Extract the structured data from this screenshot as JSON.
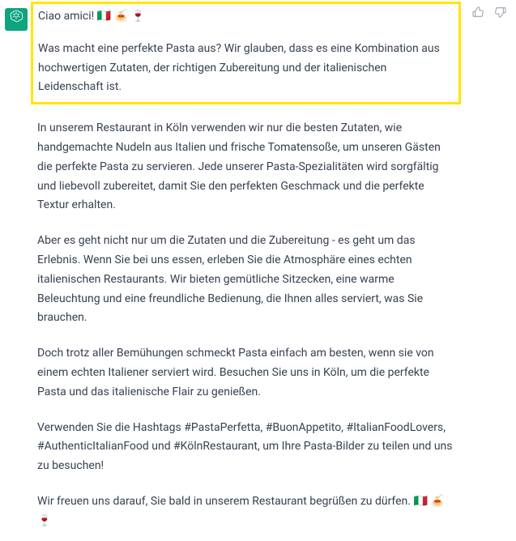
{
  "message": {
    "p1_a": "Ciao amici! 🇮🇹 🍝 🍷",
    "p1_b": "Was macht eine perfekte Pasta aus? Wir glauben, dass es eine Kombination aus hochwertigen Zutaten, der richtigen Zubereitung und der italienischen Leidenschaft ist.",
    "p2": "In unserem Restaurant in Köln verwenden wir nur die besten Zutaten, wie handgemachte Nudeln aus Italien und frische Tomatensoße, um unseren Gästen die perfekte Pasta zu servieren. Jede unserer Pasta-Spezialitäten wird sorgfältig und liebevoll zubereitet, damit Sie den perfekten Geschmack und die perfekte Textur erhalten.",
    "p3": "Aber es geht nicht nur um die Zutaten und die Zubereitung - es geht um das Erlebnis. Wenn Sie bei uns essen, erleben Sie die Atmosphäre eines echten italienischen Restaurants. Wir bieten gemütliche Sitzecken, eine warme Beleuchtung und eine freundliche Bedienung, die Ihnen alles serviert, was Sie brauchen.",
    "p4": "Doch trotz aller Bemühungen schmeckt Pasta einfach am besten, wenn sie von einem echten Italiener serviert wird. Besuchen Sie uns in Köln, um die perfekte Pasta und das italienische Flair zu genießen.",
    "p5": "Verwenden Sie die Hashtags #PastaPerfetta, #BuonAppetito, #ItalianFoodLovers, #AuthenticItalianFood und #KölnRestaurant, um Ihre Pasta-Bilder zu teilen und uns zu besuchen!",
    "p6": "Wir freuen uns darauf, Sie bald in unserem Restaurant begrüßen zu dürfen. 🇮🇹 🍝 🍷"
  },
  "icons": {
    "assistant": "openai-icon",
    "thumbs_up": "thumbs-up-icon",
    "thumbs_down": "thumbs-down-icon"
  }
}
